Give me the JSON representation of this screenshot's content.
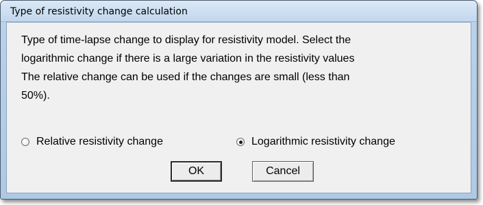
{
  "window": {
    "title": "Type of resistivity change calculation"
  },
  "dialog": {
    "message": "Type of time-lapse change to display for resistivity model. Select the\nlogarithmic change if there is a large variation in the resistivity values\nThe relative change can be used if the changes are small (less than\n50%).",
    "options": [
      {
        "label": "Relative resistivity change",
        "selected": false
      },
      {
        "label": "Logarithmic resistivity change",
        "selected": true
      }
    ],
    "buttons": {
      "ok": "OK",
      "cancel": "Cancel"
    }
  }
}
